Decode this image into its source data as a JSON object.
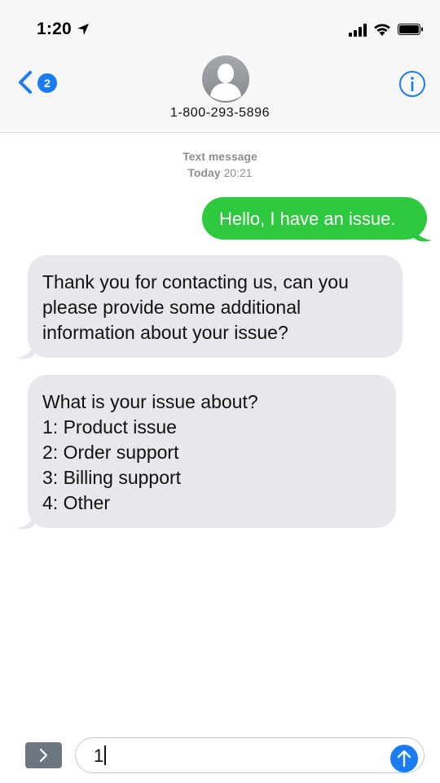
{
  "status_bar": {
    "time": "1:20",
    "icons": [
      "location-arrow-icon",
      "signal-bars-icon",
      "wifi-icon",
      "battery-icon"
    ]
  },
  "header": {
    "back_badge": "2",
    "contact_number": "1-800-293-5896",
    "avatar_icon": "person-avatar-icon",
    "info_icon": "info-icon"
  },
  "conversation": {
    "meta_label": "Text message",
    "meta_day": "Today",
    "meta_time": "20:21",
    "messages": [
      {
        "direction": "outgoing",
        "lines": [
          "Hello, I have an issue."
        ]
      },
      {
        "direction": "incoming",
        "lines": [
          "Thank you for contacting us, can you",
          "please provide some additional",
          "information about your issue?"
        ]
      },
      {
        "direction": "incoming",
        "lines": [
          "What is your issue about?",
          "1: Product issue",
          "2: Order support",
          "3: Billing support",
          "4: Other"
        ]
      }
    ]
  },
  "composer": {
    "input_value": "1",
    "apps_icon": "chevron-right-icon",
    "send_icon": "send-arrow-icon"
  },
  "colors": {
    "accent_blue": "#1a7cf5",
    "outgoing_bubble": "#2ec93f",
    "incoming_bubble": "#e8e8ec"
  }
}
